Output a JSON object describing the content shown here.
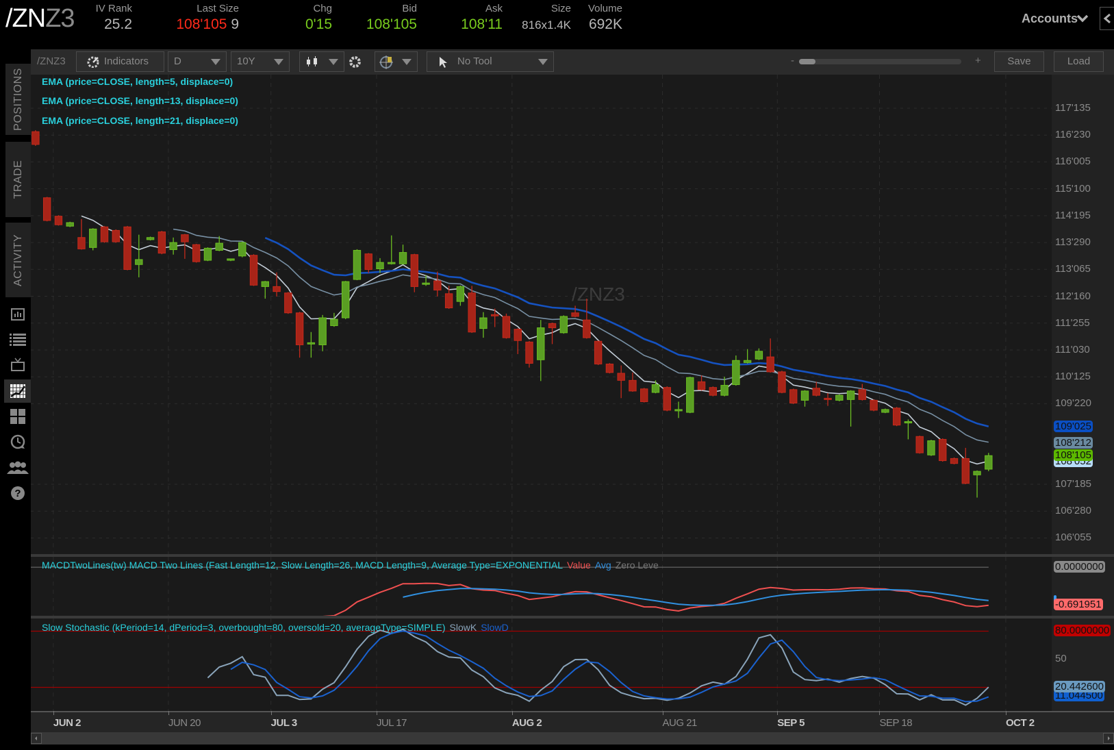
{
  "header": {
    "symbol_main": "/ZN",
    "symbol_suffix": "Z3",
    "fields": [
      {
        "label": "IV Rank",
        "value": "25.2"
      },
      {
        "label": "Last Size",
        "value": "108'105",
        "value_extra": "9"
      },
      {
        "label": "Chg",
        "value": "0'15"
      },
      {
        "label": "Bid",
        "value": "108'105"
      },
      {
        "label": "Ask",
        "value": "108'11"
      },
      {
        "label": "Size",
        "value": "816x1.4K"
      },
      {
        "label": "Volume",
        "value": "692K"
      }
    ],
    "accounts_label": "Accounts"
  },
  "toolbar": {
    "symbol": "/ZNZ3",
    "indicators_label": "Indicators",
    "aggregation": "D",
    "time_range": "10Y",
    "drawing_tool": "No Tool",
    "zoom_minus": "-",
    "zoom_plus": "+",
    "zoom_level": 0.1,
    "save_label": "Save",
    "load_label": "Load"
  },
  "sidebar": {
    "tabs": [
      "POSITIONS",
      "TRADE",
      "ACTIVITY"
    ],
    "icons": [
      "market-watch-icon",
      "list-icon",
      "tv-icon",
      "chart-icon",
      "grid-icon",
      "history-icon",
      "community-icon",
      "help-icon"
    ],
    "active_icon": "chart-icon"
  },
  "colors": {
    "up": "#5a9e23",
    "down": "#a82418",
    "ema5": "#c4ced8",
    "ema13": "#7890a4",
    "ema21": "#1552c0",
    "macd_value": "#f05050",
    "macd_avg": "#3090e0",
    "slowk": "#8aa4ba",
    "slowd": "#1a62d0",
    "legend": "#2ad0dc"
  },
  "chart_data": [
    {
      "type": "candlestick",
      "watermark": "/ZNZ3",
      "legend": [
        "EMA (price=CLOSE, length=5, displace=0)",
        "EMA (price=CLOSE, length=13, displace=0)",
        "EMA (price=CLOSE, length=21, displace=0)"
      ],
      "ema_lengths": [
        5,
        13,
        21
      ],
      "ylim": [
        105.75,
        118.3
      ],
      "grid": true,
      "y_ticks": [
        {
          "label": "117'135",
          "value": 117.4219
        },
        {
          "label": "116'230",
          "value": 116.7188
        },
        {
          "label": "116'005",
          "value": 116.0156
        },
        {
          "label": "115'100",
          "value": 115.3125
        },
        {
          "label": "114'195",
          "value": 114.6094
        },
        {
          "label": "113'290",
          "value": 113.9063
        },
        {
          "label": "113'065",
          "value": 113.2031
        },
        {
          "label": "112'160",
          "value": 112.5
        },
        {
          "label": "111'255",
          "value": 111.7969
        },
        {
          "label": "111'030",
          "value": 111.0938
        },
        {
          "label": "110'125",
          "value": 110.3906
        },
        {
          "label": "109'220",
          "value": 109.6875
        },
        {
          "label": "107'185",
          "value": 107.5781
        },
        {
          "label": "106'280",
          "value": 106.875
        },
        {
          "label": "106'055",
          "value": 106.1719
        }
      ],
      "price_bubbles": [
        {
          "label": "109'025",
          "value": 109.078,
          "color": "#0a4fc4"
        },
        {
          "label": "108'212",
          "value": 108.6625,
          "color": "#6a8aa0"
        },
        {
          "label": "108'052",
          "value": 108.1625,
          "color": "#b8dcf8"
        },
        {
          "label": "108'105",
          "value": 108.328,
          "color": "#5cb800"
        }
      ],
      "x_ticks": [
        {
          "label": "JUN 2",
          "index": 1.55,
          "major": true
        },
        {
          "label": "JUN 20",
          "index": 11.57,
          "major": false
        },
        {
          "label": "JUL 3",
          "index": 20.5,
          "major": true
        },
        {
          "label": "JUL 17",
          "index": 29.7,
          "major": false
        },
        {
          "label": "AUG 2",
          "index": 41.5,
          "major": true
        },
        {
          "label": "AUG 21",
          "index": 54.6,
          "major": false
        },
        {
          "label": "SEP 5",
          "index": 64.6,
          "major": true
        },
        {
          "label": "SEP 18",
          "index": 73.5,
          "major": false
        },
        {
          "label": "OCT 2",
          "index": 84.5,
          "major": true
        }
      ],
      "ohlc": [
        [
          116.808,
          116.845,
          116.436,
          116.473
        ],
        [
          115.078,
          115.1,
          114.46,
          114.483
        ],
        [
          114.595,
          114.62,
          114.35,
          114.371
        ],
        [
          114.334,
          114.45,
          114.31,
          114.427
        ],
        [
          114.037,
          114.52,
          113.72,
          113.739
        ],
        [
          113.776,
          114.28,
          113.702,
          114.26
        ],
        [
          114.316,
          114.34,
          113.9,
          113.925
        ],
        [
          114.223,
          114.25,
          113.9,
          113.925
        ],
        [
          114.316,
          114.34,
          113.18,
          113.2
        ],
        [
          113.33,
          114.111,
          112.995,
          113.46
        ],
        [
          113.981,
          114.06,
          113.96,
          114.037
        ],
        [
          114.185,
          114.21,
          113.6,
          113.627
        ],
        [
          113.72,
          114.037,
          113.59,
          113.906
        ],
        [
          114.111,
          114.13,
          113.479,
          113.925
        ],
        [
          113.851,
          113.87,
          113.38,
          113.404
        ],
        [
          113.441,
          113.78,
          113.42,
          113.758
        ],
        [
          113.702,
          114.074,
          113.68,
          113.888
        ],
        [
          113.441,
          113.48,
          113.42,
          113.479
        ],
        [
          113.553,
          113.93,
          113.52,
          113.906
        ],
        [
          113.572,
          113.6,
          112.77,
          112.79
        ],
        [
          112.753,
          112.9,
          112.437,
          112.883
        ],
        [
          112.753,
          113.125,
          112.493,
          112.623
        ],
        [
          112.586,
          112.61,
          112.04,
          112.065
        ],
        [
          112.065,
          112.09,
          110.893,
          111.228
        ],
        [
          111.27,
          111.563,
          110.893,
          111.284
        ],
        [
          111.228,
          112.01,
          111.06,
          111.935
        ],
        [
          111.73,
          112.065,
          111.7,
          111.898
        ],
        [
          111.935,
          112.9,
          111.9,
          112.883
        ],
        [
          112.939,
          113.73,
          112.92,
          113.702
        ],
        [
          113.609,
          113.63,
          113.107,
          113.2
        ],
        [
          113.218,
          113.497,
          113.107,
          113.385
        ],
        [
          113.37,
          114.092,
          113.33,
          113.385
        ],
        [
          113.348,
          113.851,
          113.33,
          113.646
        ],
        [
          113.59,
          113.61,
          112.604,
          112.753
        ],
        [
          112.83,
          113.051,
          112.772,
          112.846
        ],
        [
          112.902,
          113.144,
          112.493,
          112.661
        ],
        [
          112.567,
          112.772,
          112.17,
          112.195
        ],
        [
          112.363,
          112.78,
          112.251,
          112.753
        ],
        [
          112.586,
          112.772,
          111.54,
          111.563
        ],
        [
          111.656,
          112.084,
          111.414,
          111.935
        ],
        [
          112.02,
          112.177,
          111.693,
          112.009
        ],
        [
          111.972,
          112.046,
          111.39,
          111.414
        ],
        [
          111.637,
          111.66,
          110.986,
          111.34
        ],
        [
          111.302,
          111.33,
          110.633,
          110.744
        ],
        [
          110.837,
          111.879,
          110.28,
          111.674
        ],
        [
          111.786,
          111.81,
          111.247,
          111.674
        ],
        [
          111.544,
          112.0,
          111.52,
          111.972
        ],
        [
          112.065,
          112.251,
          111.95,
          111.972
        ],
        [
          111.879,
          112.437,
          111.39,
          111.414
        ],
        [
          111.321,
          111.34,
          110.7,
          110.726
        ],
        [
          110.726,
          110.75,
          110.48,
          110.503
        ],
        [
          110.484,
          110.689,
          109.833,
          110.298
        ],
        [
          110.298,
          110.503,
          110.0,
          110.019
        ],
        [
          110.075,
          110.1,
          109.72,
          109.74
        ],
        [
          109.982,
          110.298,
          109.96,
          110.186
        ],
        [
          110.112,
          110.14,
          109.49,
          109.517
        ],
        [
          109.53,
          109.74,
          109.312,
          109.535
        ],
        [
          109.461,
          110.39,
          109.44,
          110.372
        ],
        [
          110.261,
          110.428,
          110.03,
          110.056
        ],
        [
          110.112,
          110.14,
          109.88,
          109.907
        ],
        [
          109.907,
          110.391,
          109.88,
          110.168
        ],
        [
          110.186,
          110.949,
          110.16,
          110.819
        ],
        [
          110.763,
          111.116,
          110.74,
          110.819
        ],
        [
          110.856,
          111.135,
          110.83,
          111.06
        ],
        [
          110.912,
          111.395,
          110.5,
          110.521
        ],
        [
          110.521,
          110.55,
          109.96,
          109.982
        ],
        [
          110.056,
          110.08,
          109.68,
          109.703
        ],
        [
          109.777,
          110.04,
          109.61,
          110.019
        ],
        [
          110.093,
          110.261,
          109.88,
          109.907
        ],
        [
          109.83,
          109.963,
          109.629,
          109.814
        ],
        [
          109.777,
          109.93,
          109.75,
          109.907
        ],
        [
          109.796,
          110.04,
          109.089,
          110.019
        ],
        [
          110.056,
          110.205,
          109.77,
          109.796
        ],
        [
          109.777,
          109.8,
          109.49,
          109.517
        ],
        [
          109.461,
          109.56,
          109.44,
          109.535
        ],
        [
          109.573,
          109.6,
          109.1,
          109.127
        ],
        [
          109.2,
          109.275,
          108.754,
          109.219
        ],
        [
          108.829,
          108.85,
          108.38,
          108.401
        ],
        [
          108.345,
          108.74,
          108.32,
          108.717
        ],
        [
          108.754,
          108.78,
          108.17,
          108.196
        ],
        [
          108.252,
          108.28,
          108.1,
          108.122
        ],
        [
          108.252,
          108.531,
          107.58,
          107.601
        ],
        [
          107.824,
          107.94,
          107.229,
          107.917
        ],
        [
          107.973,
          108.4,
          107.92,
          108.328
        ]
      ]
    },
    {
      "type": "line",
      "title": "MACDTwoLines(tw) MACD Two Lines (Fast Length=12, Slow Length=26, MACD Length=9, Average Type=EXPONENTIAL",
      "series_names": [
        "Value",
        "Avg",
        "Zero Leve"
      ],
      "params": {
        "fast": 12,
        "slow": 26,
        "macd_length": 9
      },
      "ylim": [
        -0.9,
        0.19
      ],
      "bubbles": [
        {
          "label": "0.0000000",
          "value": 0,
          "color": "#8a8a8a"
        },
        {
          "label": "",
          "value": -0.63,
          "color": "#3a9af0"
        },
        {
          "label": "-0.691951",
          "value": -0.692,
          "color": "#ff6a6a"
        }
      ]
    },
    {
      "type": "line",
      "title": "Slow Stochastic (kPeriod=14, dPeriod=3, overbought=80, oversold=20, averageType=SIMPLE)",
      "series_names": [
        "SlowK",
        "SlowD"
      ],
      "params": {
        "k_period": 14,
        "d_period": 3,
        "overbought": 80,
        "oversold": 20
      },
      "ylim": [
        -5.2,
        93.5
      ],
      "y_ticks": [
        {
          "label": "50",
          "value": 50
        }
      ],
      "bubbles": [
        {
          "label": "80.0000000",
          "value": 80,
          "color": "#c00000"
        },
        {
          "label": "11.044500",
          "value": 11.04,
          "color": "#1060d0"
        },
        {
          "label": "20.442600",
          "value": 20.44,
          "color": "#6a9ac0"
        }
      ]
    }
  ]
}
